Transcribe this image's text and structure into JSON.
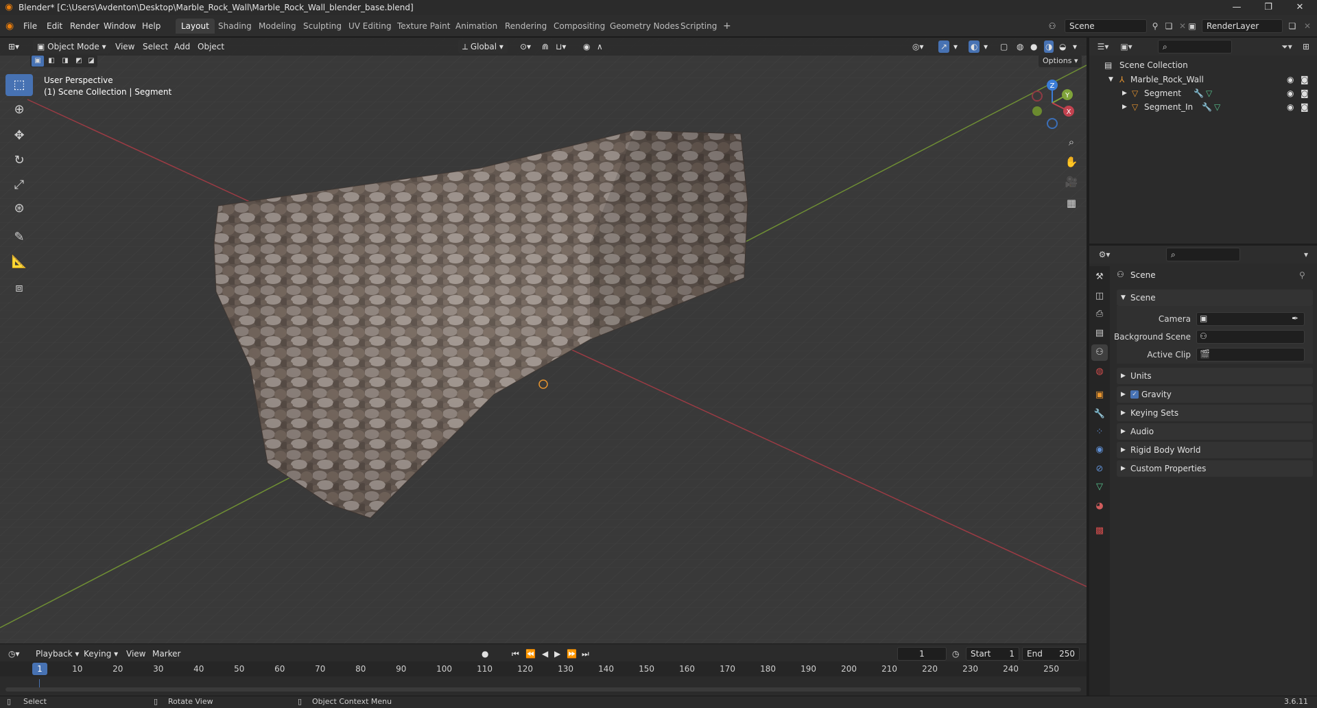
{
  "window": {
    "title": "Blender* [C:\\Users\\Avdenton\\Desktop\\Marble_Rock_Wall\\Marble_Rock_Wall_blender_base.blend]",
    "controls": [
      "—",
      "❐",
      "✕"
    ]
  },
  "menu": [
    "File",
    "Edit",
    "Render",
    "Window",
    "Help"
  ],
  "workspaces": [
    "Layout",
    "Shading",
    "Modeling",
    "Sculpting",
    "UV Editing",
    "Texture Paint",
    "Animation",
    "Rendering",
    "Compositing",
    "Geometry Nodes",
    "Scripting"
  ],
  "active_workspace": "Layout",
  "add_workspace": "+",
  "scene_field": "Scene",
  "renderlayer_field": "RenderLayer",
  "viewport_header": {
    "mode": "Object Mode",
    "menus": [
      "View",
      "Select",
      "Add",
      "Object"
    ],
    "transform_orientation": "Global",
    "options": "Options"
  },
  "viewport_overlay": {
    "perspective": "User Perspective",
    "collection": "(1) Scene Collection | Segment"
  },
  "gizmo": {
    "z": "Z",
    "y": "Y",
    "x": "X"
  },
  "outliner": {
    "root": "Scene Collection",
    "items": [
      {
        "label": "Marble_Rock_Wall",
        "level": 1
      },
      {
        "label": "Segment",
        "level": 2
      },
      {
        "label": "Segment_In",
        "level": 2
      }
    ]
  },
  "properties": {
    "breadcrumb": "Scene",
    "panel_scene": "Scene",
    "fields": [
      {
        "label": "Camera"
      },
      {
        "label": "Background Scene"
      },
      {
        "label": "Active Clip"
      }
    ],
    "panels": [
      "Units",
      "Gravity",
      "Keying Sets",
      "Audio",
      "Rigid Body World",
      "Custom Properties"
    ]
  },
  "timeline": {
    "menus": [
      "Playback",
      "Keying",
      "View",
      "Marker"
    ],
    "current_frame": "1",
    "start_label": "Start",
    "start_value": "1",
    "end_label": "End",
    "end_value": "250",
    "frames": [
      "1",
      "10",
      "20",
      "30",
      "40",
      "50",
      "60",
      "70",
      "80",
      "90",
      "100",
      "110",
      "120",
      "130",
      "140",
      "150",
      "160",
      "170",
      "180",
      "190",
      "200",
      "210",
      "220",
      "230",
      "240",
      "250"
    ]
  },
  "statusbar": {
    "select": "Select",
    "rotate": "Rotate View",
    "context": "Object Context Menu",
    "version": "3.6.11"
  },
  "colors": {
    "accent": "#4772b3",
    "x_axis": "#c2424f",
    "y_axis": "#7fa33a",
    "z_axis": "#3b7dd8",
    "object_icon": "#e8952f"
  }
}
